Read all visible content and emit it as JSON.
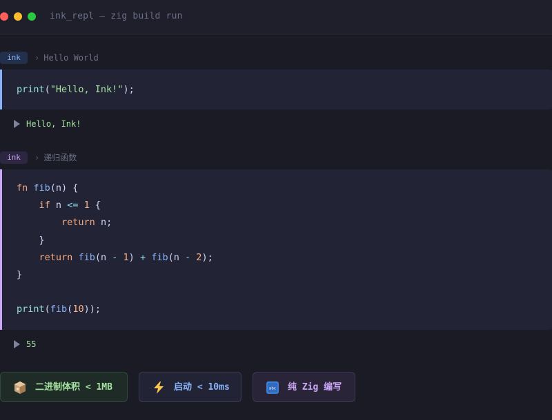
{
  "window": {
    "title": "ink_repl — zig build run"
  },
  "cells": [
    {
      "badge": "ink",
      "breadcrumb_sep": "›",
      "name": "Hello World",
      "code": [
        "print(\"Hello, Ink!\");"
      ],
      "output": "Hello, Ink!"
    },
    {
      "badge": "ink",
      "breadcrumb_sep": "›",
      "name": "递归函数",
      "code": [
        "fn fib(n) {",
        "    if n <= 1 {",
        "        return n;",
        "    }",
        "    return fib(n - 1) + fib(n - 2);",
        "}",
        "",
        "print(fib(10));"
      ],
      "output": "55"
    }
  ],
  "features": [
    {
      "icon": "package-box-icon",
      "label": "二进制体积 < 1MB",
      "color": "#a6e3a1"
    },
    {
      "icon": "lightning-icon",
      "label": "启动 < 10ms",
      "color": "#89b4fa"
    },
    {
      "icon": "abc-badge-icon",
      "label": "纯 Zig 编写",
      "color": "#cba6f7"
    }
  ],
  "colors": {
    "background": "#1b1b26",
    "panel": "#232336",
    "accent_blue": "#89b4fa",
    "accent_purple": "#cba6f7",
    "output_green": "#a6e3a1"
  }
}
